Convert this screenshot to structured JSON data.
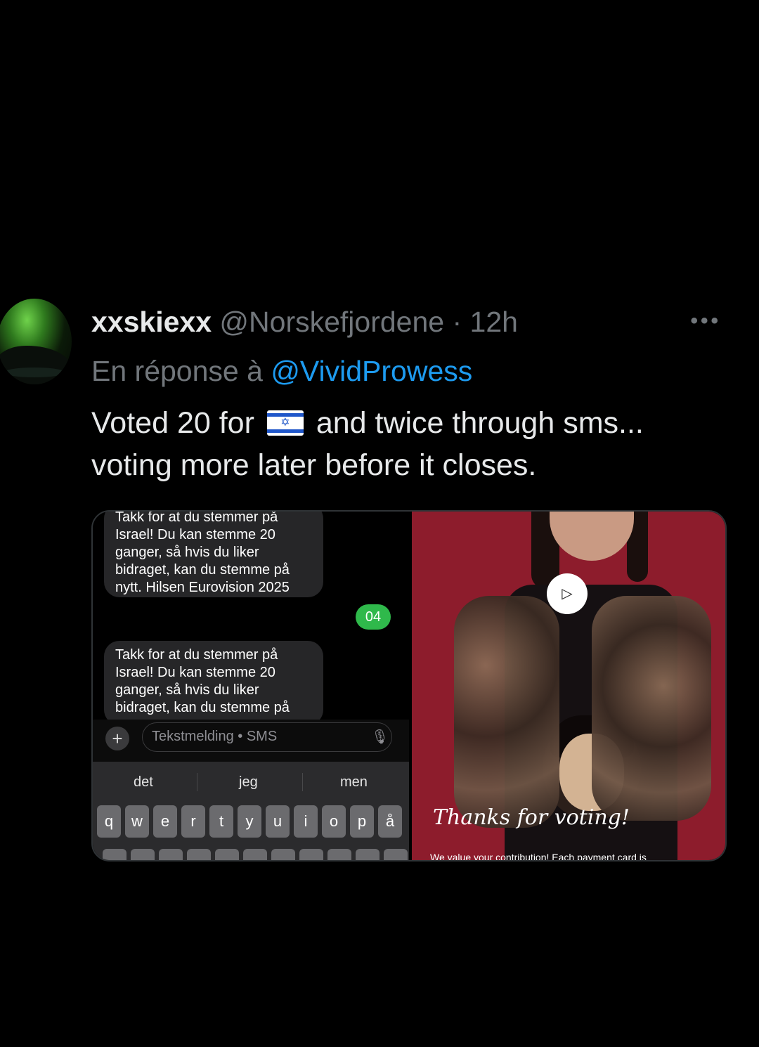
{
  "tweet": {
    "display_name": "xxskiexx",
    "handle": "@Norskefjordene",
    "separator": "·",
    "time": "12h",
    "more": "•••",
    "reply_prefix": "En réponse à",
    "reply_to": "@VividProwess",
    "text_before_flag": "Voted 20 for",
    "flag": "Israel flag",
    "text_after_flag": "and twice through sms... voting more later before it closes."
  },
  "media": {
    "left": {
      "bubble_1_text": "Takk for at du stemmer på Israel! Du kan stemme 20 ganger, så hvis du liker bidraget, kan du stemme på nytt. Hilsen Eurovision 2025",
      "sent_message": "04",
      "bubble_2_text": "Takk for at du stemmer på Israel! Du kan stemme 20 ganger, så hvis du liker bidraget, kan du stemme på",
      "input_placeholder": "Tekstmelding • SMS",
      "plus": "+",
      "suggestions": [
        "det",
        "jeg",
        "men"
      ],
      "keys_row1": [
        "q",
        "w",
        "e",
        "r",
        "t",
        "y",
        "u",
        "i",
        "o",
        "p",
        "å"
      ]
    },
    "right": {
      "play": "▷",
      "thanks_text": "Thanks for voting!",
      "contribution_text": "We value your contribution! Each payment card is"
    }
  },
  "colors": {
    "background": "#000000",
    "link": "#1d9bf0",
    "muted": "#71767b",
    "sms_green": "#2fb94b",
    "video_bg": "#8d1c2c"
  }
}
